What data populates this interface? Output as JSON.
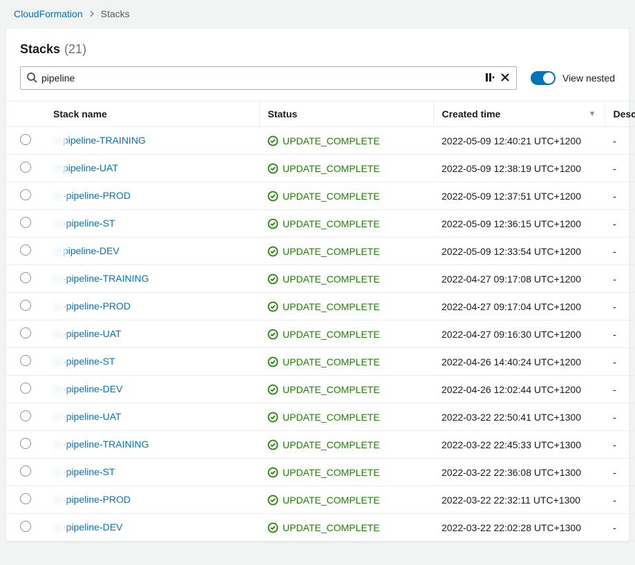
{
  "breadcrumb": {
    "root": "CloudFormation",
    "current": "Stacks"
  },
  "panel": {
    "title": "Stacks",
    "count": "(21)"
  },
  "search": {
    "value": "pipeline"
  },
  "toggle": {
    "label": "View nested"
  },
  "columns": {
    "name": "Stack name",
    "status": "Status",
    "created": "Created time",
    "description": "Descr"
  },
  "rows": [
    {
      "name": "pipeline-TRAINING",
      "status": "UPDATE_COMPLETE",
      "created": "2022-05-09 12:40:21 UTC+1200",
      "description": "-"
    },
    {
      "name": "pipeline-UAT",
      "status": "UPDATE_COMPLETE",
      "created": "2022-05-09 12:38:19 UTC+1200",
      "description": "-"
    },
    {
      "name": "-pipeline-PROD",
      "status": "UPDATE_COMPLETE",
      "created": "2022-05-09 12:37:51 UTC+1200",
      "description": "-"
    },
    {
      "name": "-pipeline-ST",
      "status": "UPDATE_COMPLETE",
      "created": "2022-05-09 12:36:15 UTC+1200",
      "description": "-"
    },
    {
      "name": "pipeline-DEV",
      "status": "UPDATE_COMPLETE",
      "created": "2022-05-09 12:33:54 UTC+1200",
      "description": "-"
    },
    {
      "name": "-pipeline-TRAINING",
      "status": "UPDATE_COMPLETE",
      "created": "2022-04-27 09:17:08 UTC+1200",
      "description": "-"
    },
    {
      "name": "-pipeline-PROD",
      "status": "UPDATE_COMPLETE",
      "created": "2022-04-27 09:17:04 UTC+1200",
      "description": "-"
    },
    {
      "name": "-pipeline-UAT",
      "status": "UPDATE_COMPLETE",
      "created": "2022-04-27 09:16:30 UTC+1200",
      "description": "-"
    },
    {
      "name": "-pipeline-ST",
      "status": "UPDATE_COMPLETE",
      "created": "2022-04-26 14:40:24 UTC+1200",
      "description": "-"
    },
    {
      "name": "-pipeline-DEV",
      "status": "UPDATE_COMPLETE",
      "created": "2022-04-26 12:02:44 UTC+1200",
      "description": "-"
    },
    {
      "name": "·pipeline-UAT",
      "status": "UPDATE_COMPLETE",
      "created": "2022-03-22 22:50:41 UTC+1300",
      "description": "-"
    },
    {
      "name": "·pipeline-TRAINING",
      "status": "UPDATE_COMPLETE",
      "created": "2022-03-22 22:45:33 UTC+1300",
      "description": "-"
    },
    {
      "name": "·pipeline-ST",
      "status": "UPDATE_COMPLETE",
      "created": "2022-03-22 22:36:08 UTC+1300",
      "description": "-"
    },
    {
      "name": "·pipeline-PROD",
      "status": "UPDATE_COMPLETE",
      "created": "2022-03-22 22:32:11 UTC+1300",
      "description": "-"
    },
    {
      "name": "·pipeline-DEV",
      "status": "UPDATE_COMPLETE",
      "created": "2022-03-22 22:02:28 UTC+1300",
      "description": "-"
    }
  ]
}
